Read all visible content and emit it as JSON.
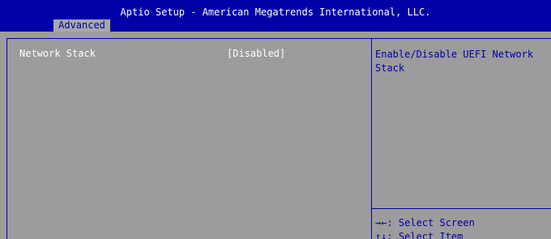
{
  "header": {
    "title": "Aptio Setup - American Megatrends International, LLC.",
    "active_tab": "Advanced"
  },
  "settings": [
    {
      "label": "Network Stack",
      "value": "[Disabled]"
    }
  ],
  "help": {
    "description": "Enable/Disable UEFI Network Stack",
    "keys": [
      {
        "key": "→←",
        "action": ": Select Screen"
      },
      {
        "key": "↑↓",
        "action": ": Select Item"
      }
    ]
  },
  "colors": {
    "header_bg": "#0000a8",
    "body_bg": "#9c9c9c",
    "text_white": "#ffffff",
    "text_blue": "#0000a8"
  }
}
